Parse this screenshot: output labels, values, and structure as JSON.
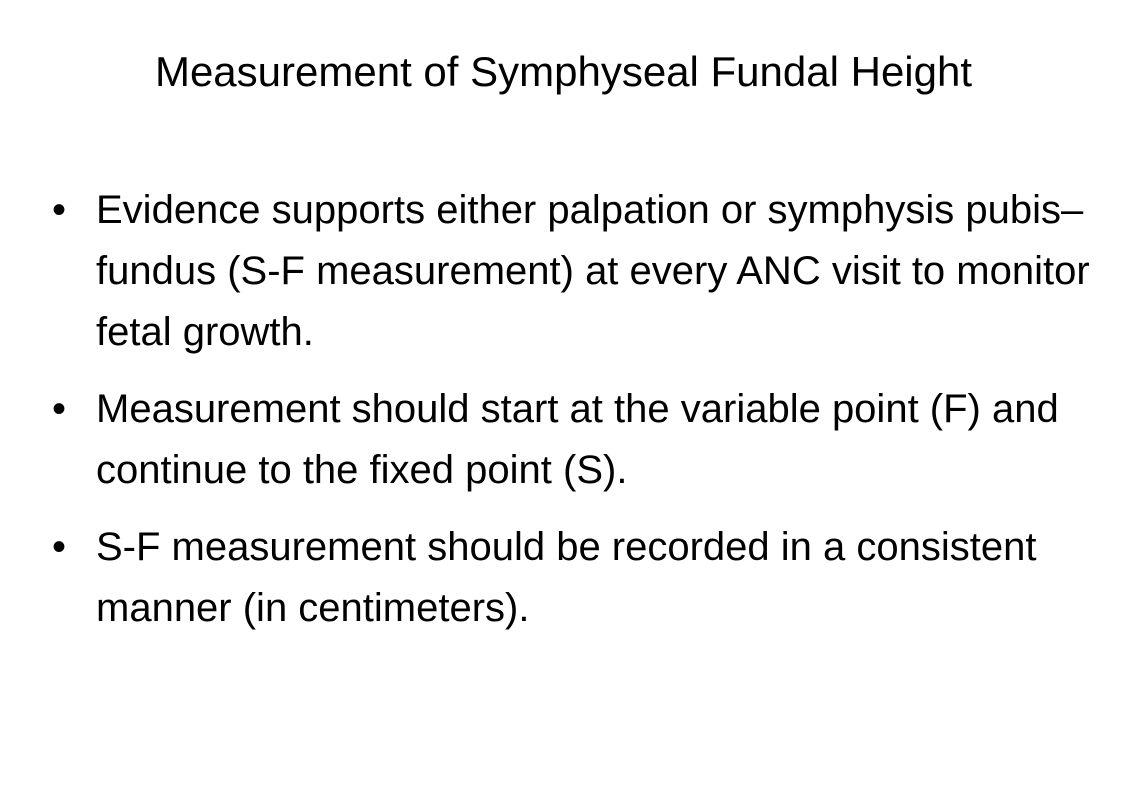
{
  "slide": {
    "title": "Measurement of Symphyseal Fundal Height",
    "bullet_symbol": "•",
    "bullets": [
      "Evidence supports either palpation or symphysis pubis–fundus (S-F measurement) at every ANC visit to monitor fetal growth.",
      "Measurement should start at the variable point (F) and continue to the fixed point (S).",
      "S-F measurement should be recorded in a consistent manner (in centimeters)."
    ]
  }
}
